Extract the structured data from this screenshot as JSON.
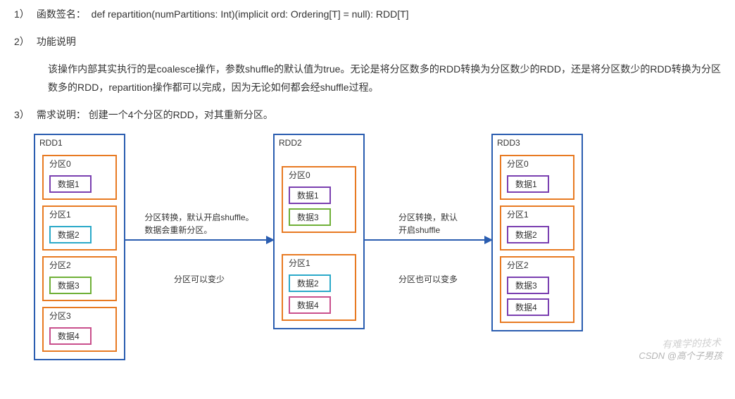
{
  "items": {
    "i1": {
      "num": "1）",
      "label": "函数签名：",
      "code": "def repartition(numPartitions: Int)(implicit ord: Ordering[T] = null): RDD[T]"
    },
    "i2": {
      "num": "2）",
      "label": "功能说明",
      "desc": "该操作内部其实执行的是coalesce操作，参数shuffle的默认值为true。无论是将分区数多的RDD转换为分区数少的RDD，还是将分区数少的RDD转换为分区数多的RDD，repartition操作都可以完成，因为无论如何都会经shuffle过程。"
    },
    "i3": {
      "num": "3）",
      "label": "需求说明：",
      "desc": "创建一个4个分区的RDD，对其重新分区。"
    }
  },
  "rdd1": {
    "title": "RDD1",
    "parts": [
      {
        "title": "分区0",
        "data": [
          {
            "text": "数据1",
            "cls": "c-purple"
          }
        ]
      },
      {
        "title": "分区1",
        "data": [
          {
            "text": "数据2",
            "cls": "c-teal"
          }
        ]
      },
      {
        "title": "分区2",
        "data": [
          {
            "text": "数据3",
            "cls": "c-green"
          }
        ]
      },
      {
        "title": "分区3",
        "data": [
          {
            "text": "数据4",
            "cls": "c-pink"
          }
        ]
      }
    ]
  },
  "rdd2": {
    "title": "RDD2",
    "parts": [
      {
        "title": "分区0",
        "data": [
          {
            "text": "数据1",
            "cls": "c-purple"
          },
          {
            "text": "数据3",
            "cls": "c-green"
          }
        ]
      },
      {
        "title": "分区1",
        "data": [
          {
            "text": "数据2",
            "cls": "c-teal"
          },
          {
            "text": "数据4",
            "cls": "c-pink"
          }
        ]
      }
    ]
  },
  "rdd3": {
    "title": "RDD3",
    "parts": [
      {
        "title": "分区0",
        "data": [
          {
            "text": "数据1",
            "cls": "c-purple"
          }
        ]
      },
      {
        "title": "分区1",
        "data": [
          {
            "text": "数据2",
            "cls": "c-purple"
          }
        ]
      },
      {
        "title": "分区2",
        "data": [
          {
            "text": "数据3",
            "cls": "c-purple"
          },
          {
            "text": "数据4",
            "cls": "c-purple"
          }
        ]
      }
    ]
  },
  "conn1": {
    "top": "分区转换，默认开启shuffle。\n数据会重新分区。",
    "bottom": "分区可以变少"
  },
  "conn2": {
    "top": "分区转换，默认\n开启shuffle",
    "bottom": "分区也可以变多"
  },
  "watermark": "CSDN @高个子男孩",
  "watermark2": "有难学的技术"
}
